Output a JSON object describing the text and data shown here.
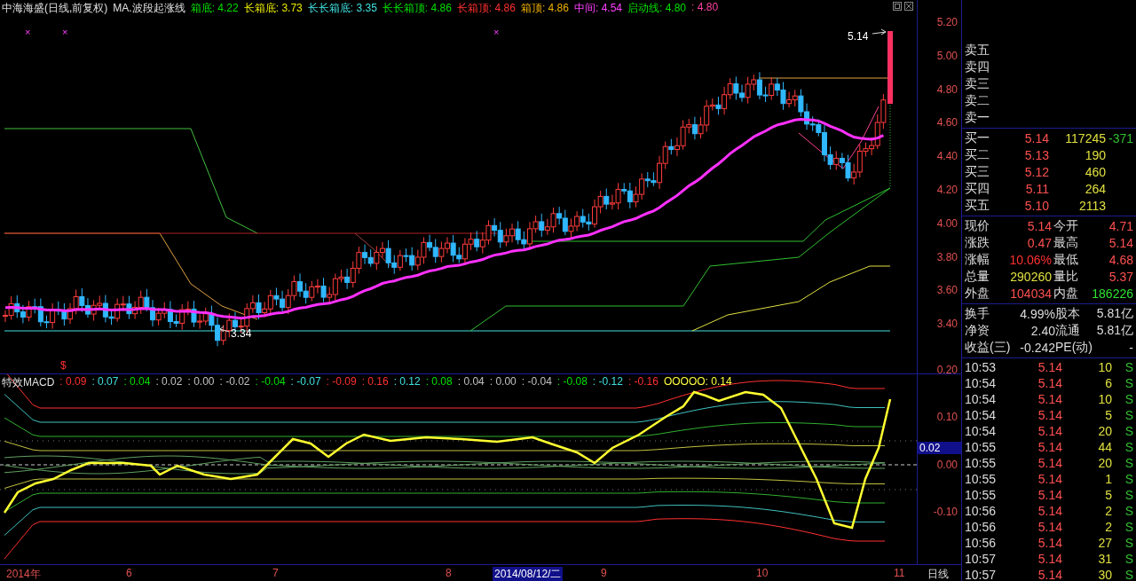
{
  "header": {
    "name": "中海海盛(日线,前复权)",
    "indicator": "MA.波段起涨线",
    "values": [
      {
        "label": "箱底:",
        "value": "4.22",
        "color": "#00e000"
      },
      {
        "label": "长箱底:",
        "value": "3.73",
        "color": "#e8e800"
      },
      {
        "label": "长长箱底:",
        "value": "3.35",
        "color": "#40e0e0"
      },
      {
        "label": "长长箱顶:",
        "value": "4.86",
        "color": "#00e000"
      },
      {
        "label": "长箱顶:",
        "value": "4.86",
        "color": "#ff3030"
      },
      {
        "label": "箱顶:",
        "value": "4.86",
        "color": "#f0b000"
      },
      {
        "label": "中间:",
        "value": "4.54",
        "color": "#ff40ff"
      },
      {
        "label": "启动线:",
        "value": "4.80",
        "color": "#00e000"
      },
      {
        "label": ":",
        "value": "4.80",
        "color": "#ff40a0"
      }
    ]
  },
  "chart_marks": {
    "high_label": "5.14",
    "low_label": "3.34",
    "signal": "$",
    "crosses": [
      "×",
      "×",
      "×"
    ]
  },
  "price_axis": [
    "5.20",
    "5.00",
    "4.80",
    "4.60",
    "4.40",
    "4.20",
    "4.00",
    "3.80",
    "3.60",
    "3.40"
  ],
  "macd": {
    "title": "特效MACD",
    "values": [
      {
        "text": ": 0.09",
        "color": "#ff3030"
      },
      {
        "text": ": 0.07",
        "color": "#40e0e0"
      },
      {
        "text": ": 0.04",
        "color": "#00e000"
      },
      {
        "text": ": 0.02",
        "color": "#c0c0c0"
      },
      {
        "text": ": 0.00",
        "color": "#c0c0c0"
      },
      {
        "text": ": -0.02",
        "color": "#c0c0c0"
      },
      {
        "text": ": -0.04",
        "color": "#00e000"
      },
      {
        "text": ": -0.07",
        "color": "#40e0e0"
      },
      {
        "text": ": -0.09",
        "color": "#ff3030"
      },
      {
        "text": ": 0.16",
        "color": "#ff3030"
      },
      {
        "text": ": 0.12",
        "color": "#40e0e0"
      },
      {
        "text": ": 0.08",
        "color": "#00e000"
      },
      {
        "text": ": 0.04",
        "color": "#c0c0c0"
      },
      {
        "text": ": 0.00",
        "color": "#c0c0c0"
      },
      {
        "text": ": -0.04",
        "color": "#c0c0c0"
      },
      {
        "text": ": -0.08",
        "color": "#00e000"
      },
      {
        "text": ": -0.12",
        "color": "#40e0e0"
      },
      {
        "text": ": -0.16",
        "color": "#ff3030"
      },
      {
        "text": "OOOOO: 0.14",
        "color": "#ffff40"
      }
    ],
    "axis": [
      "0.20",
      "0.10",
      "0.00",
      "-0.10"
    ],
    "current": "0.02"
  },
  "dates": [
    {
      "label": "2014年",
      "highlighted": false
    },
    {
      "label": "6",
      "highlighted": false
    },
    {
      "label": "7",
      "highlighted": false
    },
    {
      "label": "8",
      "highlighted": false
    },
    {
      "label": "2014/08/12/二",
      "highlighted": true
    },
    {
      "label": "9",
      "highlighted": false
    },
    {
      "label": "10",
      "highlighted": false
    },
    {
      "label": "11",
      "highlighted": false
    }
  ],
  "period": "日线",
  "sell": [
    "卖五",
    "卖四",
    "卖三",
    "卖二",
    "卖一"
  ],
  "buy": [
    {
      "label": "买一",
      "price": "5.14",
      "volume": "117245",
      "change": "-371"
    },
    {
      "label": "买二",
      "price": "5.13",
      "volume": "190"
    },
    {
      "label": "买三",
      "price": "5.12",
      "volume": "460"
    },
    {
      "label": "买四",
      "price": "5.11",
      "volume": "264"
    },
    {
      "label": "买五",
      "price": "5.10",
      "volume": "2113"
    }
  ],
  "quote": [
    {
      "left": {
        "label": "现价",
        "value": "5.14",
        "color": "#ff5050"
      },
      "right": {
        "label": "今开",
        "value": "4.71",
        "color": "#ff5050"
      }
    },
    {
      "left": {
        "label": "涨跌",
        "value": "0.47",
        "color": "#ff5050"
      },
      "right": {
        "label": "最高",
        "value": "5.14",
        "color": "#ff5050"
      }
    },
    {
      "left": {
        "label": "涨幅",
        "value": "10.06%",
        "color": "#ff3030"
      },
      "right": {
        "label": "最低",
        "value": "4.68",
        "color": "#ff5050"
      }
    },
    {
      "left": {
        "label": "总量",
        "value": "290260",
        "color": "#e0e040"
      },
      "right": {
        "label": "量比",
        "value": "5.37",
        "color": "#ff5050"
      }
    },
    {
      "left": {
        "label": "外盘",
        "value": "104034",
        "color": "#ff5050"
      },
      "right": {
        "label": "内盘",
        "value": "186226",
        "color": "#30e030"
      }
    }
  ],
  "finance": [
    {
      "l1": "换手",
      "v1": "4.99%",
      "l2": "股本",
      "v2": "5.81亿"
    },
    {
      "l1": "净资",
      "v1": "2.40",
      "l2": "流通",
      "v2": "5.81亿"
    },
    {
      "l1": "收益(三)",
      "v1": "-0.242",
      "l2": "PE(动)",
      "v2": "-"
    }
  ],
  "ticks": [
    {
      "time": "10:53",
      "price": "5.14",
      "volume": "10",
      "side": "S"
    },
    {
      "time": "10:54",
      "price": "5.14",
      "volume": "6",
      "side": "S"
    },
    {
      "time": "10:54",
      "price": "5.14",
      "volume": "10",
      "side": "S"
    },
    {
      "time": "10:54",
      "price": "5.14",
      "volume": "5",
      "side": "S"
    },
    {
      "time": "10:54",
      "price": "5.14",
      "volume": "20",
      "side": "S"
    },
    {
      "time": "10:55",
      "price": "5.14",
      "volume": "44",
      "side": "S"
    },
    {
      "time": "10:55",
      "price": "5.14",
      "volume": "20",
      "side": "S"
    },
    {
      "time": "10:55",
      "price": "5.14",
      "volume": "1",
      "side": "S"
    },
    {
      "time": "10:55",
      "price": "5.14",
      "volume": "5",
      "side": "S"
    },
    {
      "time": "10:56",
      "price": "5.14",
      "volume": "2",
      "side": "S"
    },
    {
      "time": "10:56",
      "price": "5.14",
      "volume": "2",
      "side": "S"
    },
    {
      "time": "10:56",
      "price": "5.14",
      "volume": "27",
      "side": "S"
    },
    {
      "time": "10:57",
      "price": "5.14",
      "volume": "31",
      "side": "S"
    },
    {
      "time": "10:57",
      "price": "5.14",
      "volume": "30",
      "side": "S"
    }
  ]
}
